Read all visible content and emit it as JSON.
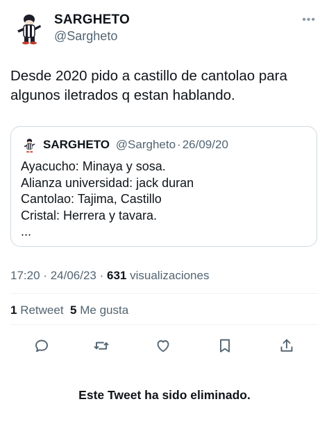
{
  "author": {
    "name": "SARGHETO",
    "handle": "@Sargheto",
    "avatar_icon": "mascot-avatar-icon",
    "more_icon": "more-options-icon"
  },
  "tweet": {
    "text": "Desde 2020 pido a castillo de cantolao para algunos iletrados q estan hablando."
  },
  "quoted_tweet": {
    "name": "SARGHETO",
    "handle": "@Sargheto",
    "separator": "·",
    "date": "26/09/20",
    "lines": [
      "Ayacucho: Minaya y sosa.",
      "Alianza universidad: jack duran",
      "Cantolao: Tajima, Castillo",
      "Cristal: Herrera y tavara.",
      "..."
    ]
  },
  "meta": {
    "time": "17:20",
    "sep1": "·",
    "date": "24/06/23",
    "sep2": "·",
    "views": "631",
    "views_label": "visualizaciones"
  },
  "stats": {
    "retweets": "1",
    "retweets_label": "Retweet",
    "likes": "5",
    "likes_label": "Me gusta"
  },
  "actions": [
    "reply-icon",
    "retweet-icon",
    "like-icon",
    "bookmark-icon",
    "share-icon"
  ],
  "notice": "Este Tweet ha sido eliminado.",
  "colors": {
    "text": "#0f1419",
    "secondary": "#536471",
    "border": "#cfd9de",
    "divider": "#eff3f4"
  }
}
